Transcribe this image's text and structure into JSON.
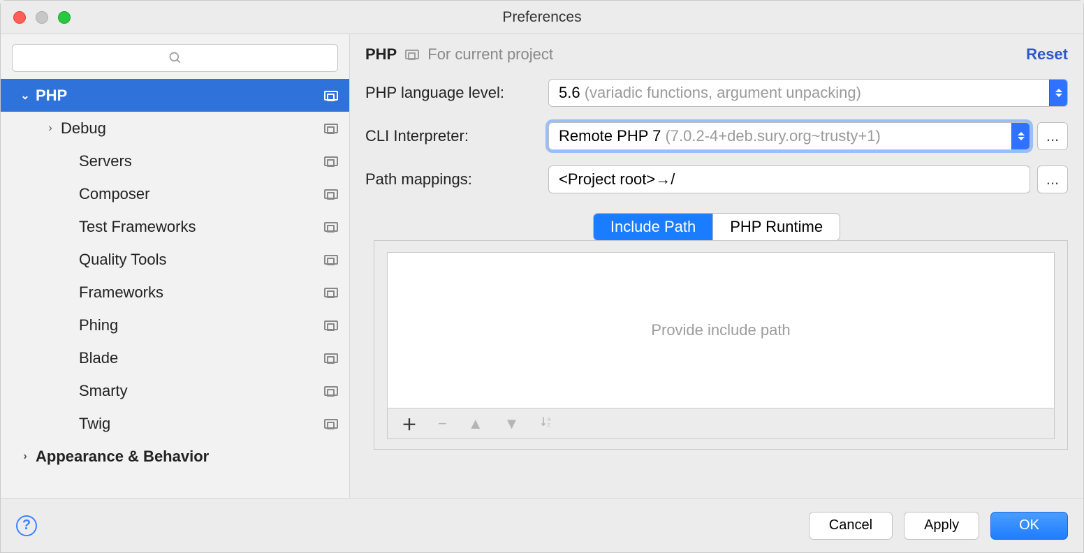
{
  "window": {
    "title": "Preferences"
  },
  "breadcrumb": {
    "title": "PHP",
    "scope": "For current project",
    "reset": "Reset"
  },
  "sidebar": {
    "items": [
      {
        "label": "PHP",
        "level": 0,
        "expanded": true,
        "selected": true,
        "bold": true,
        "hasArrow": true,
        "projScope": true
      },
      {
        "label": "Debug",
        "level": 1,
        "hasArrow": true,
        "projScope": true
      },
      {
        "label": "Servers",
        "level": 2,
        "projScope": true
      },
      {
        "label": "Composer",
        "level": 2,
        "projScope": true
      },
      {
        "label": "Test Frameworks",
        "level": 2,
        "projScope": true
      },
      {
        "label": "Quality Tools",
        "level": 2,
        "projScope": true
      },
      {
        "label": "Frameworks",
        "level": 2,
        "projScope": true
      },
      {
        "label": "Phing",
        "level": 2,
        "projScope": true
      },
      {
        "label": "Blade",
        "level": 2,
        "projScope": true
      },
      {
        "label": "Smarty",
        "level": 2,
        "projScope": true
      },
      {
        "label": "Twig",
        "level": 2,
        "projScope": true
      },
      {
        "label": "Appearance & Behavior",
        "level": 0,
        "hasArrow": true,
        "bold": true
      }
    ]
  },
  "form": {
    "lang_label": "PHP language level:",
    "lang_value": "5.6",
    "lang_hint": "(variadic functions, argument unpacking)",
    "cli_label": "CLI Interpreter:",
    "cli_value": "Remote PHP 7",
    "cli_hint": "(7.0.2-4+deb.sury.org~trusty+1)",
    "map_label": "Path mappings:",
    "map_value": "<Project root>→/",
    "ellipsis": "..."
  },
  "tabs": {
    "include": "Include Path",
    "runtime": "PHP Runtime"
  },
  "include_panel": {
    "placeholder": "Provide include path"
  },
  "footer": {
    "help": "?",
    "cancel": "Cancel",
    "apply": "Apply",
    "ok": "OK"
  }
}
